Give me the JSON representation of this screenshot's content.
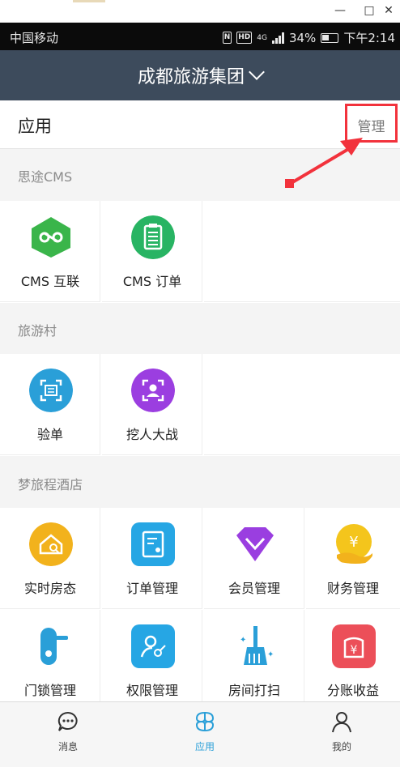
{
  "window": {
    "minimize": "—",
    "maximize": "□",
    "close": "✕"
  },
  "status_bar": {
    "carrier": "中国移动",
    "network": "4G",
    "battery": "34%",
    "time": "下午2:14"
  },
  "header": {
    "title": "成都旅游集团"
  },
  "app_bar": {
    "title": "应用",
    "manage_label": "管理"
  },
  "sections": [
    {
      "label": "思途CMS",
      "apps": [
        {
          "label": "CMS 互联",
          "icon": "link-icon",
          "color": "#3ab54a"
        },
        {
          "label": "CMS 订单",
          "icon": "clipboard-icon",
          "color": "#28b463"
        }
      ]
    },
    {
      "label": "旅游村",
      "apps": [
        {
          "label": "验单",
          "icon": "scan-icon",
          "color": "#2a9fd8"
        },
        {
          "label": "挖人大战",
          "icon": "person-scan-icon",
          "color": "#9b3ee0"
        }
      ]
    },
    {
      "label": "梦旅程酒店",
      "apps": [
        {
          "label": "实时房态",
          "icon": "house-search-icon",
          "color": "#f2b21c"
        },
        {
          "label": "订单管理",
          "icon": "order-icon",
          "color": "#26a6e4"
        },
        {
          "label": "会员管理",
          "icon": "diamond-icon",
          "color": "#9a3ee0"
        },
        {
          "label": "财务管理",
          "icon": "yuan-hand-icon",
          "color": "#f4c51c"
        },
        {
          "label": "门锁管理",
          "icon": "door-lock-icon",
          "color": "#2a9fd8"
        },
        {
          "label": "权限管理",
          "icon": "user-key-icon",
          "color": "#26a6e4"
        },
        {
          "label": "房间打扫",
          "icon": "broom-icon",
          "color": "#2a9fd8"
        },
        {
          "label": "分账收益",
          "icon": "yuan-bag-icon",
          "color": "#ec4f59"
        }
      ]
    }
  ],
  "tabs": [
    {
      "label": "消息",
      "icon": "chat-icon"
    },
    {
      "label": "应用",
      "icon": "apps-icon"
    },
    {
      "label": "我的",
      "icon": "user-icon"
    }
  ],
  "accent": "#2a9fd8",
  "highlight": "#f2323c"
}
